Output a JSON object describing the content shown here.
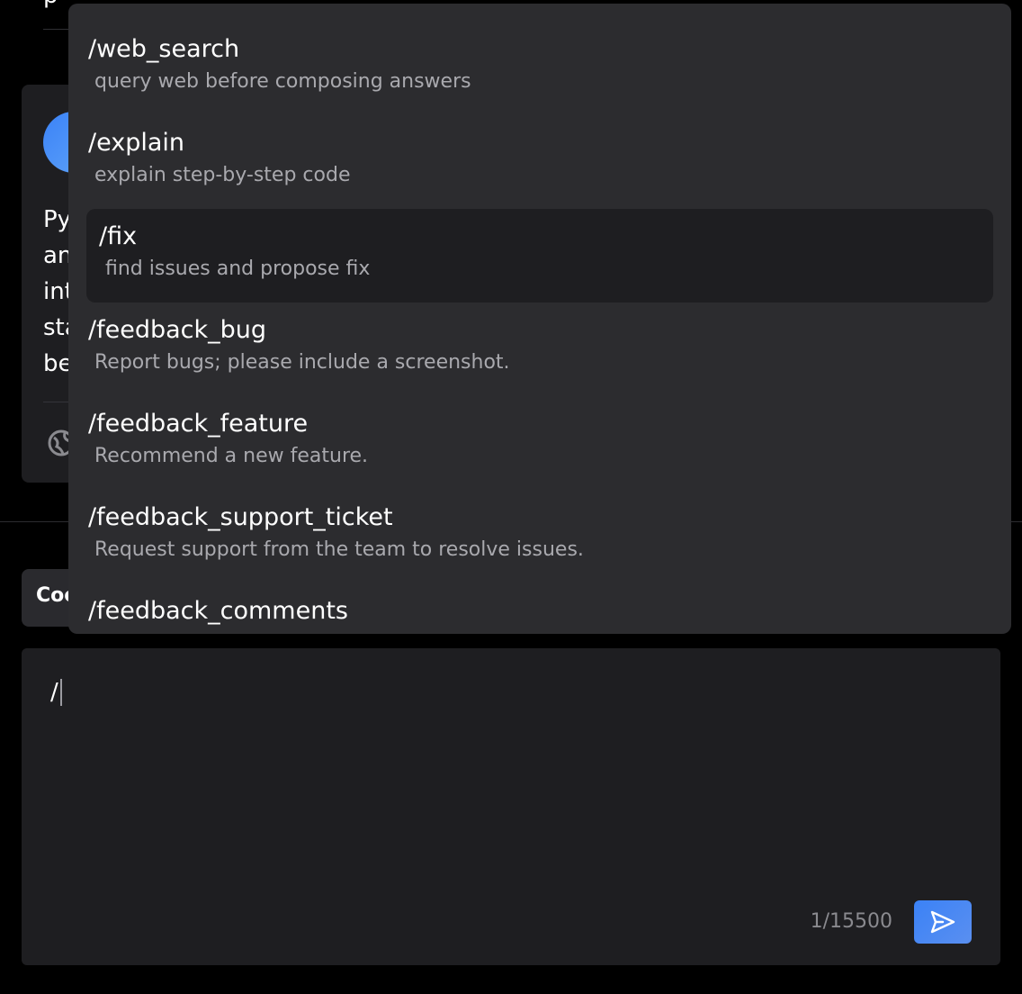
{
  "background_chat": {
    "top_fragment": "p",
    "message_lines": [
      "Py",
      "an",
      "int",
      "sta",
      "be"
    ],
    "code_chip_label": "Coc"
  },
  "command_menu": {
    "items": [
      {
        "command": "/web_search",
        "description": "query web before composing answers",
        "active": false
      },
      {
        "command": "/explain",
        "description": "explain step-by-step code",
        "active": false
      },
      {
        "command": "/fix",
        "description": "find issues and propose fix",
        "active": true
      },
      {
        "command": "/feedback_bug",
        "description": "Report bugs; please include a screenshot.",
        "active": false
      },
      {
        "command": "/feedback_feature",
        "description": "Recommend a new feature.",
        "active": false
      },
      {
        "command": "/feedback_support_ticket",
        "description": "Request support from the team to resolve issues.",
        "active": false
      },
      {
        "command": "/feedback_comments",
        "description": "",
        "active": false
      }
    ]
  },
  "composer": {
    "input_value": "/",
    "char_count": "1/15500",
    "send_icon": "send-icon"
  },
  "colors": {
    "background": "#000000",
    "card": "#1e1e21",
    "menu": "#2c2c2f",
    "accent": "#3b82f6",
    "muted_text": "#a9a9ae"
  }
}
